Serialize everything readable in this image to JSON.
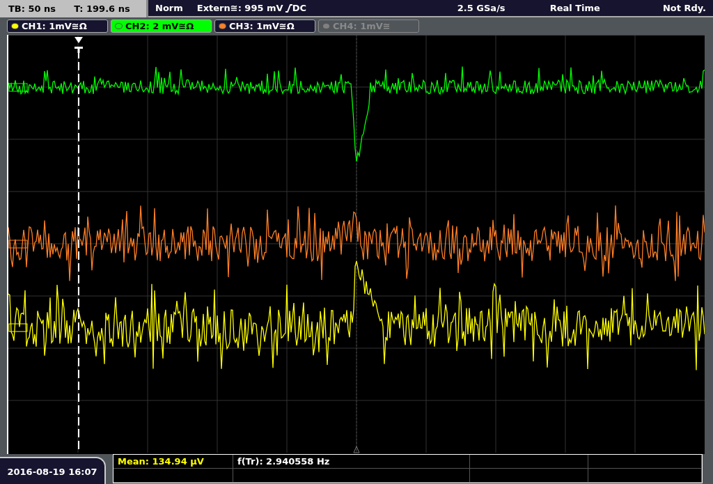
{
  "status_bar": {
    "timebase": "TB: 50 ns",
    "trigger_time": "T: 199.6 ns",
    "trigger_mode": "Norm",
    "trigger_level": "Extern≅: 995 mV",
    "coupling": "DC",
    "sample_rate": "2.5 GSa/s",
    "acquisition": "Real Time",
    "state": "Not Rdy."
  },
  "channels": [
    {
      "label": "CH1: 1mV≅Ω",
      "color": "#ffff00",
      "selected": false,
      "disabled": false
    },
    {
      "label": "CH2: 2 mV≅Ω",
      "color": "#00ff00",
      "selected": true,
      "disabled": false
    },
    {
      "label": "CH3: 1mV≅Ω",
      "color": "#ff7f27",
      "selected": false,
      "disabled": false
    },
    {
      "label": "CH4: 1mV≅",
      "color": "#808080",
      "selected": false,
      "disabled": true
    }
  ],
  "date": "2016-08-19 16:07",
  "measurements": [
    {
      "text": "Mean: 134.94 µV",
      "color": "#ffff00"
    },
    {
      "text": "f(Tr): 2.940558 Hz",
      "color": "#ffffff"
    }
  ]
}
